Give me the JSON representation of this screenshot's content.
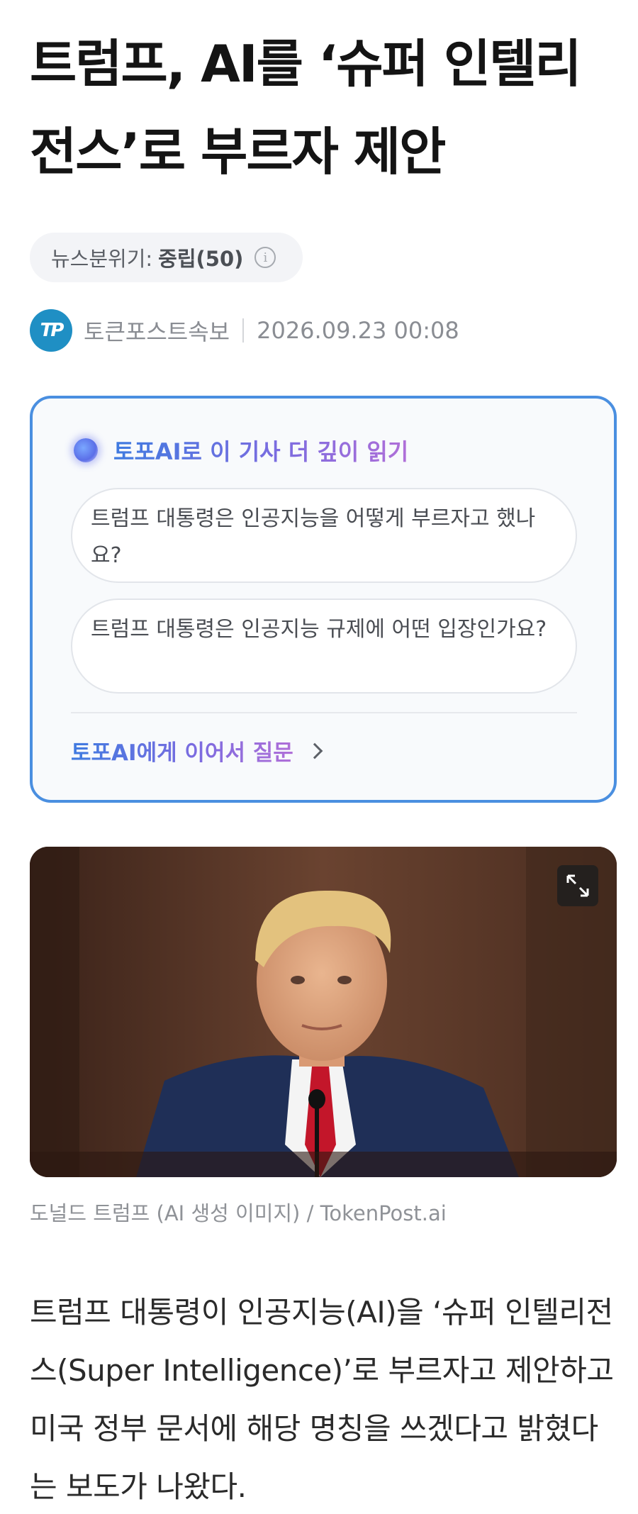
{
  "article": {
    "title": "트럼프, AI를 ‘슈퍼 인텔리전스’로 부르자 제안",
    "mood_label": "뉴스분위기:",
    "mood_value": "중립(50)",
    "source_name": "토큰포스트속보",
    "source_logo_text": "TP",
    "published_at": "2026.09.23 00:08"
  },
  "ai_card": {
    "heading": "토포AI로 이 기사 더 깊이 읽기",
    "questions": [
      "트럼프 대통령은 인공지능을 어떻게 부르자고 했나요?",
      "트럼프 대통령은 인공지능 규제에 어떤 입장인가요?"
    ],
    "followup_label": "토포AI에게 이어서 질문"
  },
  "image": {
    "caption": "도널드 트럼프 (AI 생성 이미지) / TokenPost.ai",
    "expand_icon": "expand-icon"
  },
  "body": {
    "paragraph": "트럼프 대통령이 인공지능(AI)을 ‘슈퍼 인텔리전스(Super Intelligence)’로 부르자고 제안하고 미국 정부 문서에 해당 명칭을 쓰겠다고 밝혔다는 보도가 나왔다."
  },
  "colors": {
    "accent_blue": "#4a8fe0",
    "logo_blue": "#1f8fc4"
  }
}
